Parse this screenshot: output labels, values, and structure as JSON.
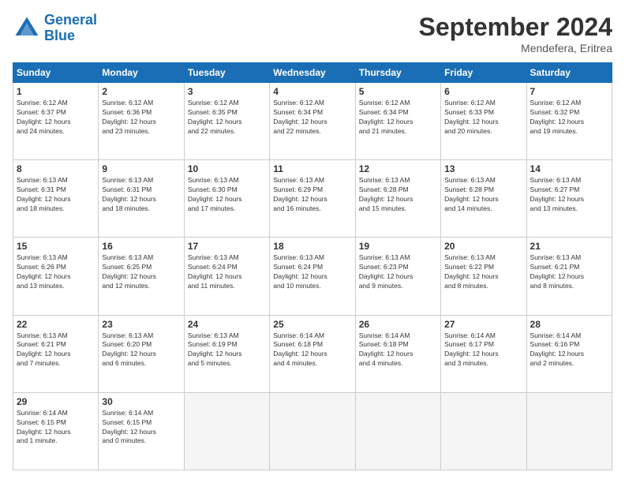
{
  "logo": {
    "line1": "General",
    "line2": "Blue"
  },
  "title": "September 2024",
  "subtitle": "Mendefera, Eritrea",
  "days_header": [
    "Sunday",
    "Monday",
    "Tuesday",
    "Wednesday",
    "Thursday",
    "Friday",
    "Saturday"
  ],
  "weeks": [
    [
      {
        "day": "1",
        "lines": [
          "Sunrise: 6:12 AM",
          "Sunset: 6:37 PM",
          "Daylight: 12 hours",
          "and 24 minutes."
        ]
      },
      {
        "day": "2",
        "lines": [
          "Sunrise: 6:12 AM",
          "Sunset: 6:36 PM",
          "Daylight: 12 hours",
          "and 23 minutes."
        ]
      },
      {
        "day": "3",
        "lines": [
          "Sunrise: 6:12 AM",
          "Sunset: 6:35 PM",
          "Daylight: 12 hours",
          "and 22 minutes."
        ]
      },
      {
        "day": "4",
        "lines": [
          "Sunrise: 6:12 AM",
          "Sunset: 6:34 PM",
          "Daylight: 12 hours",
          "and 22 minutes."
        ]
      },
      {
        "day": "5",
        "lines": [
          "Sunrise: 6:12 AM",
          "Sunset: 6:34 PM",
          "Daylight: 12 hours",
          "and 21 minutes."
        ]
      },
      {
        "day": "6",
        "lines": [
          "Sunrise: 6:12 AM",
          "Sunset: 6:33 PM",
          "Daylight: 12 hours",
          "and 20 minutes."
        ]
      },
      {
        "day": "7",
        "lines": [
          "Sunrise: 6:12 AM",
          "Sunset: 6:32 PM",
          "Daylight: 12 hours",
          "and 19 minutes."
        ]
      }
    ],
    [
      {
        "day": "8",
        "lines": [
          "Sunrise: 6:13 AM",
          "Sunset: 6:31 PM",
          "Daylight: 12 hours",
          "and 18 minutes."
        ]
      },
      {
        "day": "9",
        "lines": [
          "Sunrise: 6:13 AM",
          "Sunset: 6:31 PM",
          "Daylight: 12 hours",
          "and 18 minutes."
        ]
      },
      {
        "day": "10",
        "lines": [
          "Sunrise: 6:13 AM",
          "Sunset: 6:30 PM",
          "Daylight: 12 hours",
          "and 17 minutes."
        ]
      },
      {
        "day": "11",
        "lines": [
          "Sunrise: 6:13 AM",
          "Sunset: 6:29 PM",
          "Daylight: 12 hours",
          "and 16 minutes."
        ]
      },
      {
        "day": "12",
        "lines": [
          "Sunrise: 6:13 AM",
          "Sunset: 6:28 PM",
          "Daylight: 12 hours",
          "and 15 minutes."
        ]
      },
      {
        "day": "13",
        "lines": [
          "Sunrise: 6:13 AM",
          "Sunset: 6:28 PM",
          "Daylight: 12 hours",
          "and 14 minutes."
        ]
      },
      {
        "day": "14",
        "lines": [
          "Sunrise: 6:13 AM",
          "Sunset: 6:27 PM",
          "Daylight: 12 hours",
          "and 13 minutes."
        ]
      }
    ],
    [
      {
        "day": "15",
        "lines": [
          "Sunrise: 6:13 AM",
          "Sunset: 6:26 PM",
          "Daylight: 12 hours",
          "and 13 minutes."
        ]
      },
      {
        "day": "16",
        "lines": [
          "Sunrise: 6:13 AM",
          "Sunset: 6:25 PM",
          "Daylight: 12 hours",
          "and 12 minutes."
        ]
      },
      {
        "day": "17",
        "lines": [
          "Sunrise: 6:13 AM",
          "Sunset: 6:24 PM",
          "Daylight: 12 hours",
          "and 11 minutes."
        ]
      },
      {
        "day": "18",
        "lines": [
          "Sunrise: 6:13 AM",
          "Sunset: 6:24 PM",
          "Daylight: 12 hours",
          "and 10 minutes."
        ]
      },
      {
        "day": "19",
        "lines": [
          "Sunrise: 6:13 AM",
          "Sunset: 6:23 PM",
          "Daylight: 12 hours",
          "and 9 minutes."
        ]
      },
      {
        "day": "20",
        "lines": [
          "Sunrise: 6:13 AM",
          "Sunset: 6:22 PM",
          "Daylight: 12 hours",
          "and 8 minutes."
        ]
      },
      {
        "day": "21",
        "lines": [
          "Sunrise: 6:13 AM",
          "Sunset: 6:21 PM",
          "Daylight: 12 hours",
          "and 8 minutes."
        ]
      }
    ],
    [
      {
        "day": "22",
        "lines": [
          "Sunrise: 6:13 AM",
          "Sunset: 6:21 PM",
          "Daylight: 12 hours",
          "and 7 minutes."
        ]
      },
      {
        "day": "23",
        "lines": [
          "Sunrise: 6:13 AM",
          "Sunset: 6:20 PM",
          "Daylight: 12 hours",
          "and 6 minutes."
        ]
      },
      {
        "day": "24",
        "lines": [
          "Sunrise: 6:13 AM",
          "Sunset: 6:19 PM",
          "Daylight: 12 hours",
          "and 5 minutes."
        ]
      },
      {
        "day": "25",
        "lines": [
          "Sunrise: 6:14 AM",
          "Sunset: 6:18 PM",
          "Daylight: 12 hours",
          "and 4 minutes."
        ]
      },
      {
        "day": "26",
        "lines": [
          "Sunrise: 6:14 AM",
          "Sunset: 6:18 PM",
          "Daylight: 12 hours",
          "and 4 minutes."
        ]
      },
      {
        "day": "27",
        "lines": [
          "Sunrise: 6:14 AM",
          "Sunset: 6:17 PM",
          "Daylight: 12 hours",
          "and 3 minutes."
        ]
      },
      {
        "day": "28",
        "lines": [
          "Sunrise: 6:14 AM",
          "Sunset: 6:16 PM",
          "Daylight: 12 hours",
          "and 2 minutes."
        ]
      }
    ],
    [
      {
        "day": "29",
        "lines": [
          "Sunrise: 6:14 AM",
          "Sunset: 6:15 PM",
          "Daylight: 12 hours",
          "and 1 minute."
        ]
      },
      {
        "day": "30",
        "lines": [
          "Sunrise: 6:14 AM",
          "Sunset: 6:15 PM",
          "Daylight: 12 hours",
          "and 0 minutes."
        ]
      },
      {
        "day": "",
        "lines": []
      },
      {
        "day": "",
        "lines": []
      },
      {
        "day": "",
        "lines": []
      },
      {
        "day": "",
        "lines": []
      },
      {
        "day": "",
        "lines": []
      }
    ]
  ]
}
